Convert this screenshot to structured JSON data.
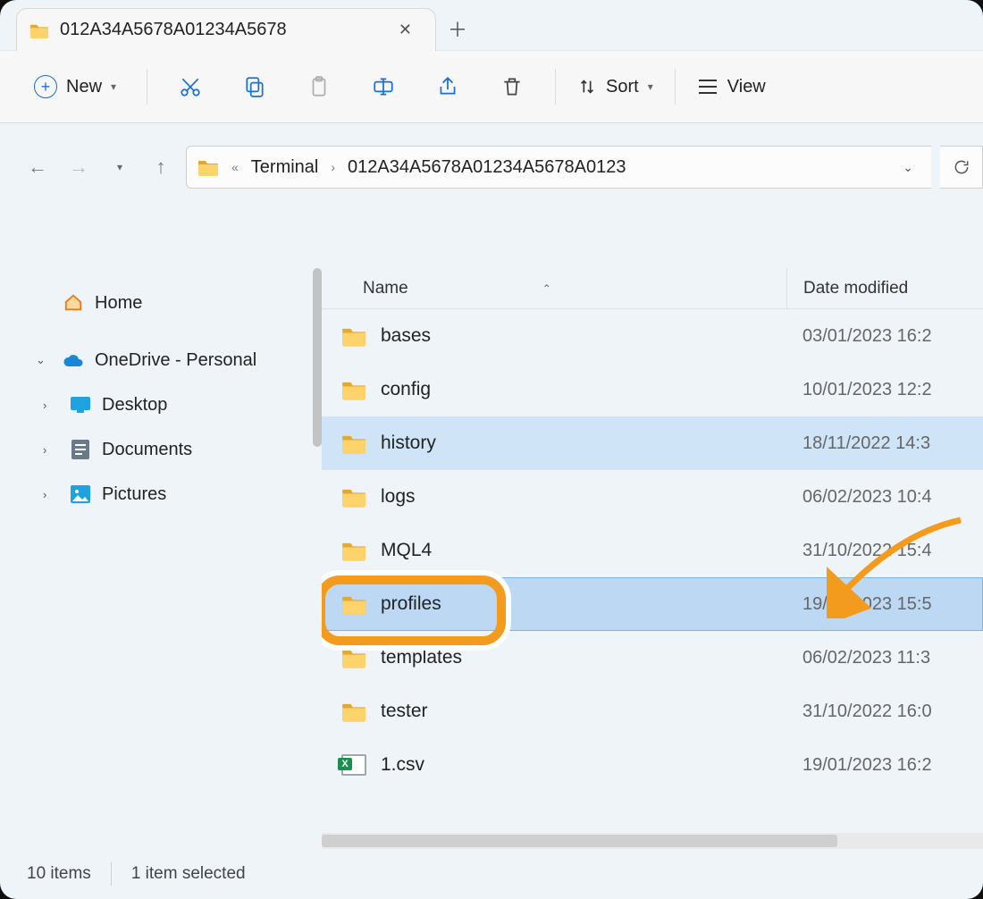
{
  "tab": {
    "title": "012A34A5678A01234A5678"
  },
  "toolbar": {
    "new_label": "New",
    "sort_label": "Sort",
    "view_label": "View"
  },
  "breadcrumb": {
    "parent": "Terminal",
    "current": "012A34A5678A01234A5678A0123"
  },
  "columns": {
    "name": "Name",
    "date": "Date modified"
  },
  "sidebar": {
    "home": "Home",
    "onedrive": "OneDrive - Personal",
    "desktop": "Desktop",
    "documents": "Documents",
    "pictures": "Pictures"
  },
  "files": [
    {
      "name": "bases",
      "date": "03/01/2023 16:2",
      "type": "folder",
      "state": ""
    },
    {
      "name": "config",
      "date": "10/01/2023 12:2",
      "type": "folder",
      "state": ""
    },
    {
      "name": "history",
      "date": "18/11/2022 14:3",
      "type": "folder",
      "state": "sel"
    },
    {
      "name": "logs",
      "date": "06/02/2023 10:4",
      "type": "folder",
      "state": ""
    },
    {
      "name": "MQL4",
      "date": "31/10/2022 15:4",
      "type": "folder",
      "state": ""
    },
    {
      "name": "profiles",
      "date": "19/01/2023 15:5",
      "type": "folder",
      "state": "sel-focus"
    },
    {
      "name": "templates",
      "date": "06/02/2023 11:3",
      "type": "folder",
      "state": ""
    },
    {
      "name": "tester",
      "date": "31/10/2022 16:0",
      "type": "folder",
      "state": ""
    },
    {
      "name": "1.csv",
      "date": "19/01/2023 16:2",
      "type": "csv",
      "state": ""
    }
  ],
  "status": {
    "count": "10 items",
    "selection": "1 item selected"
  }
}
